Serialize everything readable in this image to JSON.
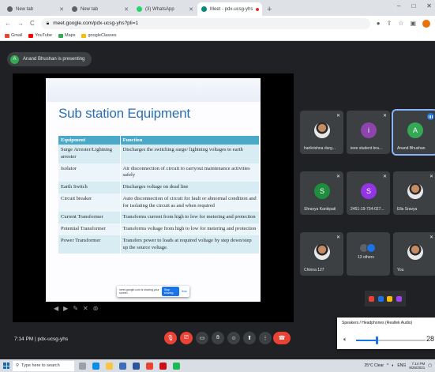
{
  "browser": {
    "tabs": [
      {
        "title": "New tab",
        "color": "#5f6368",
        "active": false
      },
      {
        "title": "New tab",
        "color": "#5f6368",
        "active": false
      },
      {
        "title": "(3) WhatsApp",
        "color": "#25d366",
        "active": false
      },
      {
        "title": "Meet - pdx-ucsg-yhs",
        "color": "#00897b",
        "active": true
      }
    ],
    "new_tab_symbol": "+",
    "window_controls": [
      "–",
      "□",
      "✕"
    ],
    "url": "meet.google.com/pdx-ucsg-yhs?pli=1",
    "bookmarks": [
      {
        "label": "Gmail",
        "color": "#ea4335"
      },
      {
        "label": "YouTube",
        "color": "#ff0000"
      },
      {
        "label": "Maps",
        "color": "#34a853"
      },
      {
        "label": "googleClasses",
        "color": "#fbbc04"
      }
    ]
  },
  "meet": {
    "presenting_initial": "A",
    "presenting_text": "Anand Bhushan is presenting",
    "time_code": "7:14 PM | pdx-ucsg-yhs",
    "participants": [
      {
        "name": "harikrishna durg...",
        "initial": "",
        "color": "",
        "photo": true,
        "muted": true
      },
      {
        "name": "ieee student bra...",
        "initial": "i",
        "color": "#8e44ad",
        "photo": false,
        "muted": true
      },
      {
        "name": "Anand Bhushan",
        "initial": "A",
        "color": "#34a853",
        "photo": false,
        "muted": false,
        "speaking": true
      },
      {
        "name": "Shravya Kankipati",
        "initial": "S",
        "color": "#1e8e3e",
        "photo": false,
        "muted": true
      },
      {
        "name": "2461-19-734-027...",
        "initial": "S",
        "color": "#9334e6",
        "photo": false,
        "muted": true
      },
      {
        "name": "Ella Sravya",
        "initial": "",
        "color": "",
        "photo": true,
        "muted": true
      },
      {
        "name": "Chinna 127",
        "initial": "",
        "color": "",
        "photo": true,
        "muted": true
      },
      {
        "name": "13 others",
        "initial": "",
        "color": "",
        "photo": false,
        "muted": false
      },
      {
        "name": "You",
        "initial": "",
        "color": "",
        "photo": true,
        "muted": true
      }
    ],
    "muted_icon": "mic-off-icon"
  },
  "slide": {
    "title": "Sub station Equipment",
    "header": [
      "Equipment",
      "Function"
    ],
    "rows": [
      [
        "Surge Arrester/Lightning arrester",
        "Discharges the switching surge/ lightning voltages to earth"
      ],
      [
        "Isolator",
        "Air disconnection of circuit to carryout maintenance activities safely"
      ],
      [
        "Earth Switch",
        "Discharges voltage on dead line"
      ],
      [
        "Circuit breaker",
        "Auto disconnection of circuit for fault or abnormal condition and for isolating the circuit as and when required"
      ],
      [
        "Current Transformer",
        "Transforms current from high to low for metering and protection"
      ],
      [
        "Potential Transformer",
        "Transforms voltage from high to low for metering and protection"
      ],
      [
        "Power Transformer",
        "Transfers power to loads at required voltage by step down/step up the source voltage."
      ]
    ],
    "toast_text": "meet.google.com is sharing your screen.",
    "toast_button": "Stop sharing",
    "toast_link": "Hide"
  },
  "audio": {
    "device": "Speakers / Headphones (Realtek Audio)",
    "volume": 28,
    "volume_text": "28"
  },
  "taskbar": {
    "search_placeholder": "Type here to search",
    "weather": "25°C Clear",
    "language": "ENG",
    "time": "7:14 PM",
    "date": "9/26/2021"
  }
}
